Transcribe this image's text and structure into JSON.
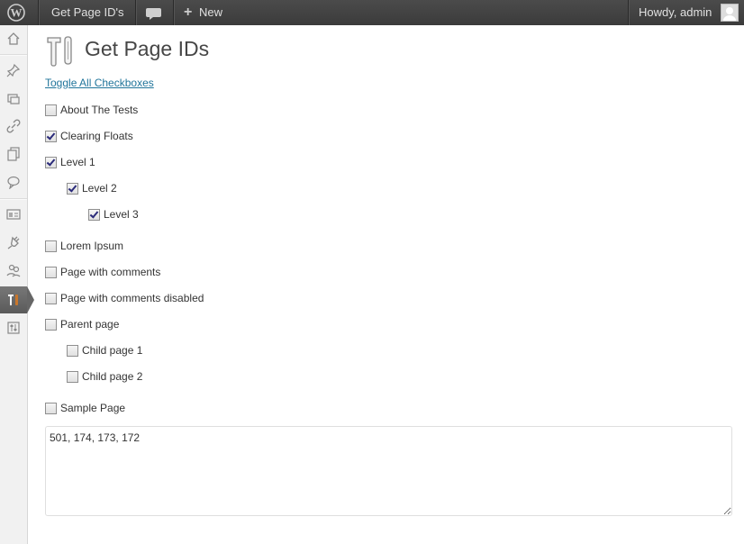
{
  "adminbar": {
    "site_name": "Get Page ID's",
    "new_label": "New",
    "greeting": "Howdy, admin"
  },
  "sidebar": {
    "items": [
      {
        "icon": "dashboard-icon"
      },
      {
        "icon": "posts-pin-icon"
      },
      {
        "icon": "media-icon"
      },
      {
        "icon": "links-icon"
      },
      {
        "icon": "pages-icon"
      },
      {
        "icon": "comments-icon"
      },
      {
        "icon": "appearance-icon"
      },
      {
        "icon": "plugins-icon"
      },
      {
        "icon": "users-icon"
      },
      {
        "icon": "tools-icon",
        "current": true
      },
      {
        "icon": "settings-icon"
      }
    ]
  },
  "page": {
    "title": "Get Page IDs",
    "toggle_link": "Toggle All Checkboxes",
    "checkboxes": [
      {
        "label": "About The Tests",
        "checked": false,
        "level": 0
      },
      {
        "label": "Clearing Floats",
        "checked": true,
        "level": 0
      },
      {
        "label": "Level 1",
        "checked": true,
        "level": 0
      },
      {
        "label": "Level 2",
        "checked": true,
        "level": 1
      },
      {
        "label": "Level 3",
        "checked": true,
        "level": 2
      },
      {
        "label": "Lorem Ipsum",
        "checked": false,
        "level": 0
      },
      {
        "label": "Page with comments",
        "checked": false,
        "level": 0
      },
      {
        "label": "Page with comments disabled",
        "checked": false,
        "level": 0
      },
      {
        "label": "Parent page",
        "checked": false,
        "level": 0
      },
      {
        "label": "Child page 1",
        "checked": false,
        "level": 1
      },
      {
        "label": "Child page 2",
        "checked": false,
        "level": 1
      },
      {
        "label": "Sample Page",
        "checked": false,
        "level": 0
      }
    ],
    "ids_output": "501, 174, 173, 172"
  },
  "colors": {
    "adminbar_bg": "#464646",
    "link": "#21759b",
    "current_menu": "#666666"
  }
}
